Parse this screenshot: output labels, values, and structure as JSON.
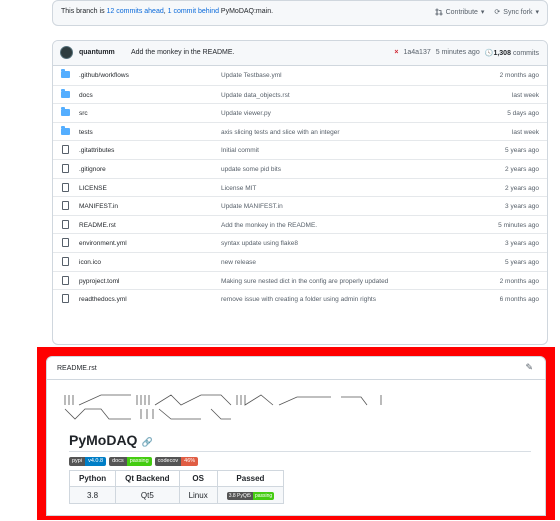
{
  "branch_bar": {
    "prefix": "This branch is ",
    "ahead": "12 commits ahead",
    "comma": ", ",
    "behind": "1 commit behind",
    "suffix": " PyMoDAQ:main.",
    "contribute": "Contribute",
    "sync": "Sync fork"
  },
  "latest_commit": {
    "author": "quantumm",
    "message": "Add the monkey in the README.",
    "status": "×",
    "hash": "1a4a137",
    "time": "5 minutes ago",
    "commits": "1,308",
    "commits_label": "commits"
  },
  "files": [
    {
      "type": "folder",
      "name": ".github/workflows",
      "message": "Update Testbase.yml",
      "age": "2 months ago"
    },
    {
      "type": "folder",
      "name": "docs",
      "message": "Update data_objects.rst",
      "age": "last week"
    },
    {
      "type": "folder",
      "name": "src",
      "message": "Update viewer.py",
      "age": "5 days ago"
    },
    {
      "type": "folder",
      "name": "tests",
      "message": "axis slicing tests and slice with an integer",
      "age": "last week"
    },
    {
      "type": "file",
      "name": ".gitattributes",
      "message": "Initial commit",
      "age": "5 years ago"
    },
    {
      "type": "file",
      "name": ".gitignore",
      "message": "update some pid bits",
      "age": "2 years ago"
    },
    {
      "type": "file",
      "name": "LICENSE",
      "message": "License MIT",
      "age": "2 years ago"
    },
    {
      "type": "file",
      "name": "MANIFEST.in",
      "message": "Update MANIFEST.in",
      "age": "3 years ago"
    },
    {
      "type": "file",
      "name": "README.rst",
      "message": "Add the monkey in the README.",
      "age": "5 minutes ago"
    },
    {
      "type": "file",
      "name": "environment.yml",
      "message": "syntax update using flake8",
      "age": "3 years ago"
    },
    {
      "type": "file",
      "name": "icon.ico",
      "message": "new release",
      "age": "5 years ago"
    },
    {
      "type": "file",
      "name": "pyproject.toml",
      "message": "Making sure nested dict in the config are properly updated",
      "age": "2 months ago"
    },
    {
      "type": "file",
      "name": "readthedocs.yml",
      "message": "remove issue with creating a folder using admin rights",
      "age": "6 months ago"
    }
  ],
  "readme": {
    "filename": "README.rst",
    "title": "PyMoDAQ",
    "badges": [
      {
        "left": "pypi",
        "right": "v4.0.8",
        "color": "#007ec6"
      },
      {
        "left": "docs",
        "right": "passing",
        "color": "#4c1"
      },
      {
        "left": "codecov",
        "right": "46%",
        "color": "#e05d44"
      }
    ],
    "table": {
      "headers": [
        "Python",
        "Qt Backend",
        "OS",
        "Passed"
      ],
      "rows": [
        [
          "3.8",
          "Qt5",
          "Linux",
          ""
        ]
      ]
    },
    "passed_badge": {
      "left": "3.8 PyQt5",
      "right": "passing"
    }
  },
  "colors": {
    "accent": "#0969da",
    "highlight": "#ff0000"
  }
}
